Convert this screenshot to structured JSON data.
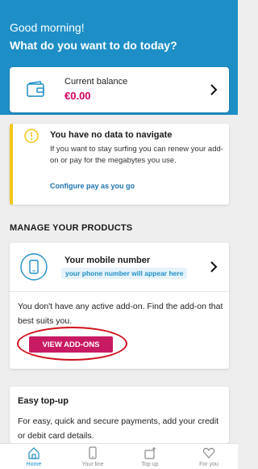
{
  "header": {
    "greeting": "Good morning!",
    "question": "What do you want to do today?"
  },
  "balance": {
    "label": "Current balance",
    "value": "€0.00"
  },
  "alert": {
    "title": "You have no data to navigate",
    "body": "If you want to stay surfing you can renew your add-on or pay for the megabytes you use.",
    "link": "Configure pay as you go"
  },
  "products": {
    "section_title": "MANAGE YOUR PRODUCTS",
    "mobile_label": "Your mobile number",
    "phone_note": "your phone number will appear here",
    "no_addon_text": "You don't have any active add-on. Find the add-on that best suits you.",
    "button_label": "VIEW ADD-ONS"
  },
  "topup": {
    "title": "Easy top-up",
    "text": "For easy, quick and secure payments, add your credit or debit card details."
  },
  "nav": {
    "items": [
      {
        "label": "Home",
        "icon": "home-icon"
      },
      {
        "label": "Your line",
        "icon": "phone-icon"
      },
      {
        "label": "Top up",
        "icon": "topup-icon"
      },
      {
        "label": "For you",
        "icon": "heart-icon"
      }
    ]
  },
  "colors": {
    "header_bg": "#1e8fc6",
    "accent": "#c81a63",
    "balance_value": "#d6005f",
    "alert_border": "#f5c518",
    "highlight_ring": "#d0101c"
  }
}
